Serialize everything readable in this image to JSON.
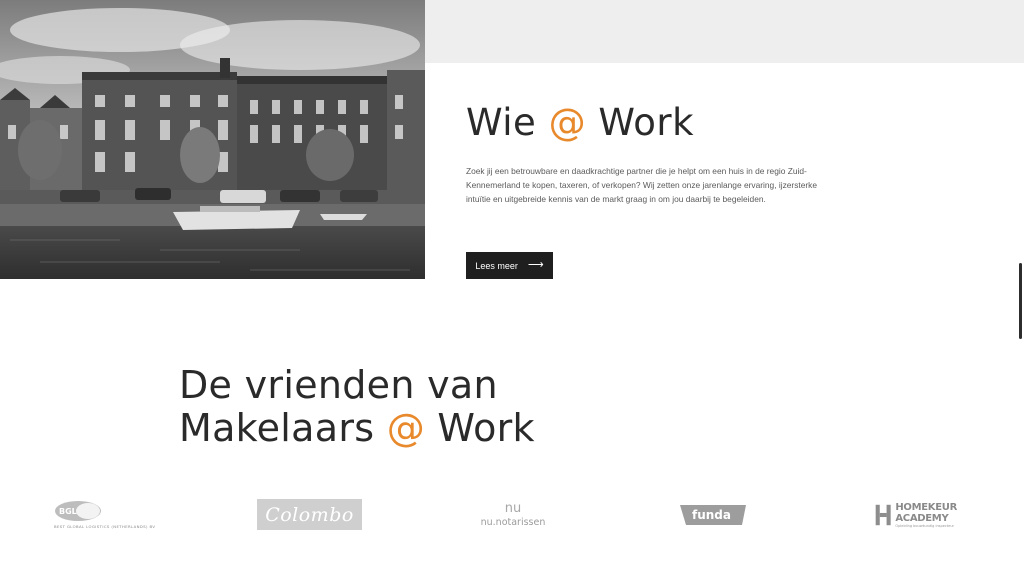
{
  "hero": {
    "image_alt": "canal houses black and white photo"
  },
  "about": {
    "title_pre": "Wie ",
    "title_at": "@",
    "title_post": " Work",
    "body": "Zoek jij een betrouwbare en daadkrachtige partner die je helpt om een huis in de regio Zuid-Kennemerland te kopen, taxeren, of verkopen? Wij zetten onze jarenlange ervaring, ijzersterke intuïtie en uitgebreide kennis van de markt graag in om jou daarbij te begeleiden.",
    "button_label": "Lees meer",
    "button_icon": "arrow-right-icon"
  },
  "friends": {
    "title_line1": "De vrienden van",
    "title_line2_pre": "Makelaars ",
    "title_line2_at": "@",
    "title_line2_post": " Work"
  },
  "partners": {
    "bgl": {
      "mark": "BGL",
      "subtitle": "BEST GLOBAL LOGISTICS (NETHERLANDS) BV"
    },
    "colombo": {
      "name": "Colombo"
    },
    "notarissen": {
      "mark": "nu",
      "name": "nu.notarissen"
    },
    "funda": {
      "name": "funda"
    },
    "homekeur": {
      "line1": "HOMEKEUR",
      "line2": "ACADEMY",
      "sub": "Opleiding bouwkundig inspecteur"
    }
  },
  "colors": {
    "accent": "#e8892c",
    "button_bg": "#1f1f1f",
    "band": "#eeeeee"
  }
}
